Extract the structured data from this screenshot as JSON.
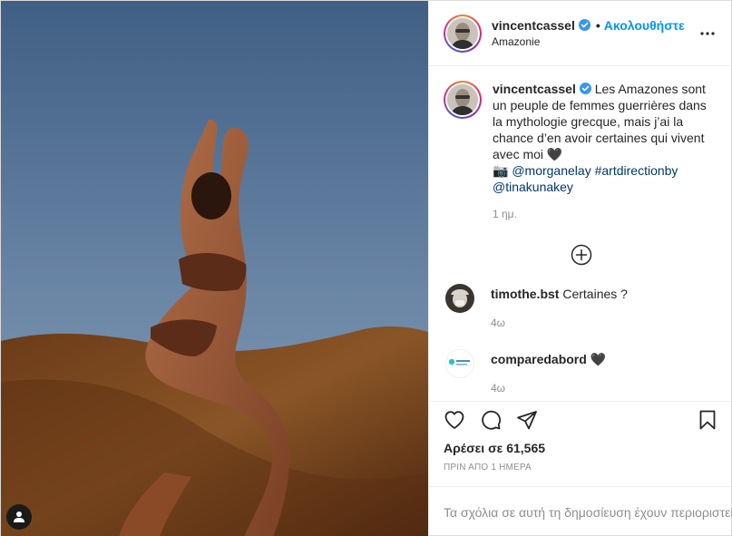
{
  "post": {
    "author": "vincentcassel",
    "follow_label": "Ακολουθήστε",
    "dot": "•",
    "location": "Amazonie",
    "caption_lines": [
      "Les Amazones sont",
      "un peuple de femmes guerrières dans",
      "la mythologie grecque, mais j’ai la",
      "chance d’en avoir certaines qui vivent",
      "avec moi 🖤"
    ],
    "credit_icon": "📷",
    "mention_1": "@morganelay",
    "hashtag": "#artdirectionby",
    "mention_2": "@tinakunakey",
    "caption_time": "1 ημ."
  },
  "comments": [
    {
      "user": "timothe.bst",
      "text": "Certaines ?",
      "time": "4ω"
    },
    {
      "user": "comparedabord",
      "text": "🖤",
      "time": "4ω"
    }
  ],
  "likes_label": "Αρέσει σε 61,565",
  "posted_label": "ΠΡΙΝ ΑΠΟ 1 ΗΜΕΡΑ",
  "comments_restricted": "Τα σχόλια σε αυτή τη δημοσίευση έχουν περιοριστεί.",
  "icons": {
    "verified": "verified-badge-icon",
    "more": "more-options-icon",
    "load_more": "plus-circle-icon",
    "like": "heart-icon",
    "comment": "comment-bubble-icon",
    "share": "paper-plane-icon",
    "save": "bookmark-icon",
    "tagged": "person-tag-icon"
  },
  "colors": {
    "accent": "#0095f6",
    "link": "#00376b",
    "verified": "#3897f0",
    "muted": "#8e8e8e"
  }
}
